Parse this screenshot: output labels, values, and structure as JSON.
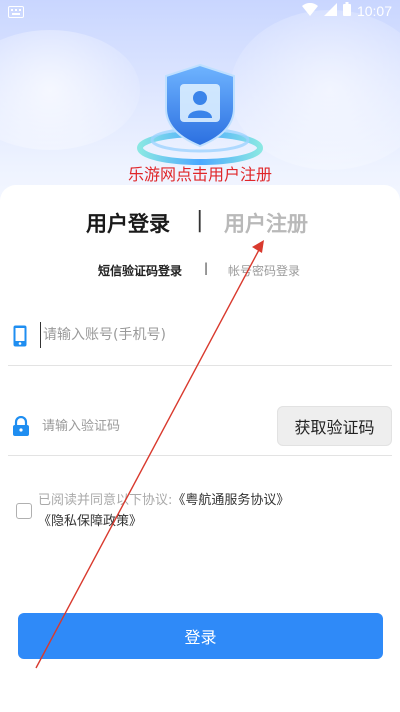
{
  "status_bar": {
    "time": "10:07",
    "icons": [
      "keyboard-icon",
      "wifi-icon",
      "signal-icon",
      "battery-icon"
    ]
  },
  "hero": {
    "caption": "乐游网点击用户注册"
  },
  "tabs": {
    "login": "用户登录",
    "separator": "|",
    "register": "用户注册"
  },
  "subtabs": {
    "sms": "短信验证码登录",
    "separator": "|",
    "password": "帐号密码登录"
  },
  "form": {
    "phone_placeholder": "请输入账号(手机号)",
    "code_placeholder": "请输入验证码",
    "get_code_label": "获取验证码"
  },
  "agreement": {
    "prefix": "已阅读并同意以下协议:",
    "link1": "《粤航通服务协议》",
    "link2": "《隐私保障政策》"
  },
  "login_button": "登录",
  "colors": {
    "primary": "#2f8af8",
    "caption_red": "#e0262a",
    "annotation_arrow": "#d93a2e",
    "inactive_tab": "#b9b9b9"
  }
}
